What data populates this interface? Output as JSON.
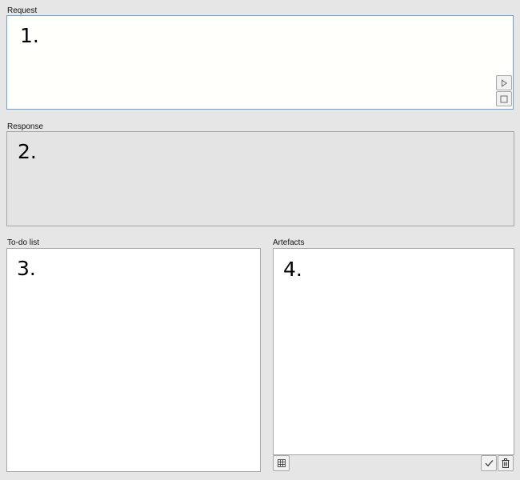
{
  "request": {
    "label": "Request",
    "number": "1."
  },
  "response": {
    "label": "Response",
    "number": "2."
  },
  "todo": {
    "label": "To-do list",
    "number": "3."
  },
  "artefacts": {
    "label": "Artefacts",
    "number": "4."
  },
  "icons": {
    "send": "play-triangle-icon",
    "stop": "stop-square-icon",
    "grid": "grid-icon",
    "accept": "checkmark-icon",
    "delete": "trash-icon"
  },
  "colors": {
    "background": "#e6e6e6",
    "request_border": "#6d9fd8",
    "request_fill": "#fffffb",
    "response_fill": "#e4e4e4",
    "panel_border": "#a5a5a5"
  }
}
